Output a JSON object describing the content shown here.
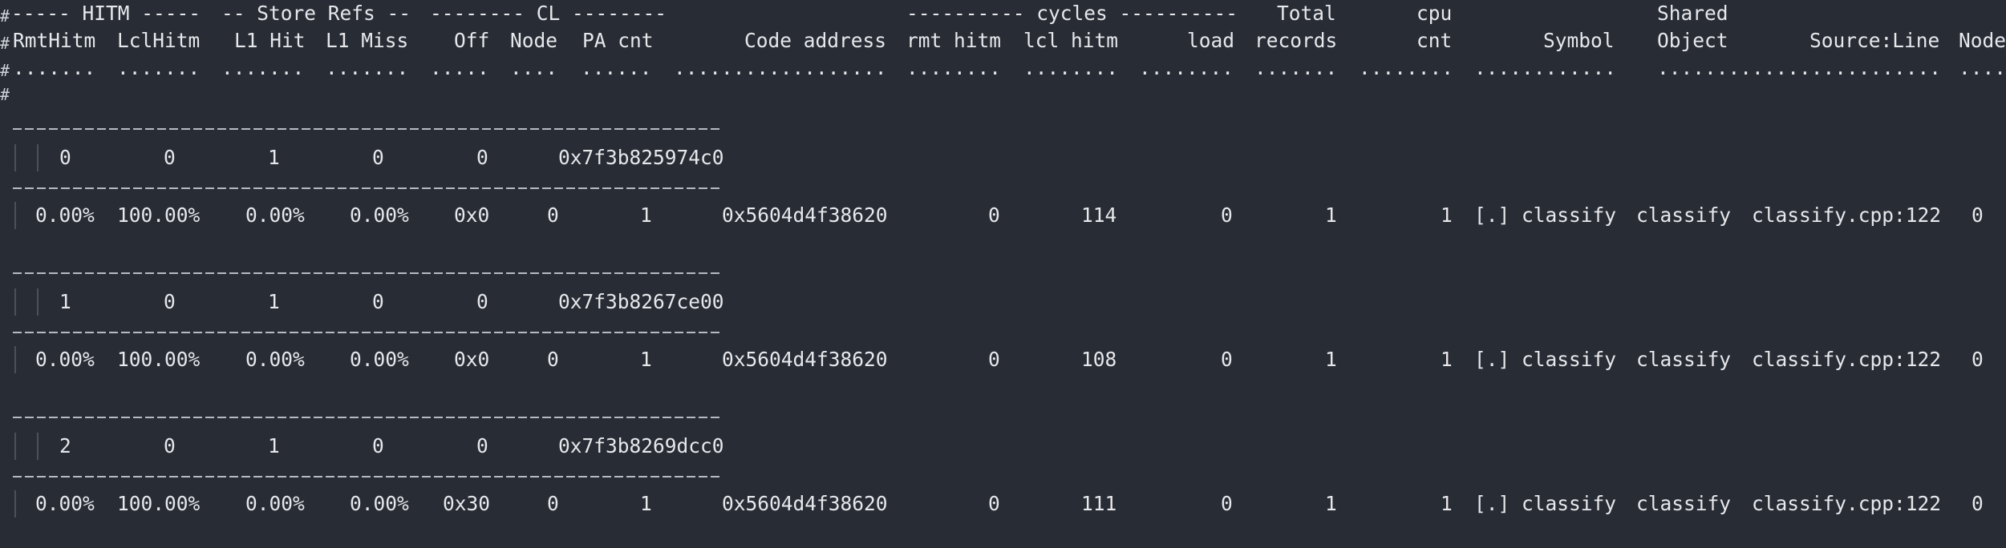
{
  "header": {
    "group_hitm": "----- HITM -----",
    "group_store": "-- Store Refs --",
    "group_cl": "-------- CL --------",
    "group_cycles": "---------- cycles ----------",
    "total_top": "Total",
    "cpu_top": "cpu",
    "shared_top": "Shared",
    "columns": {
      "rmt_hitm": "RmtHitm",
      "lcl_hitm": "LclHitm",
      "l1_hit": "L1 Hit",
      "l1_miss": "L1 Miss",
      "off": "Off",
      "node": "Node",
      "pa_cnt": "PA cnt",
      "code_address": "Code address",
      "cyc_rmt_hitm": "rmt hitm",
      "cyc_lcl_hitm": "lcl hitm",
      "cyc_load": "load",
      "total_records": "records",
      "cpu_cnt": "cnt",
      "symbol": "Symbol",
      "shared_object": "Object",
      "source_line": "Source:Line",
      "node_tail": "Node"
    },
    "dots": {
      "rmt_hitm": ".......",
      "lcl_hitm": ".......",
      "l1_hit": ".......",
      "l1_miss": ".......",
      "off": ".....",
      "node": "....",
      "pa_cnt": "......",
      "code_address": "..................",
      "cyc_rmt_hitm": "........",
      "cyc_lcl_hitm": "........",
      "cyc_load": "........",
      "total_records": ".......",
      "cpu_cnt": "........",
      "symbol": "............",
      "shared_object": "........",
      "source_line": "................",
      "node_tail": "...."
    }
  },
  "cachelines": [
    {
      "index": "0",
      "rmt_hitm": "0",
      "l1_hit": "1",
      "l1_miss": "0",
      "store_miss": "0",
      "address": "0x7f3b825974c0",
      "row": {
        "rmt_hitm": "0.00%",
        "lcl_hitm": "100.00%",
        "l1_hit": "0.00%",
        "l1_miss": "0.00%",
        "off": "0x0",
        "node": "0",
        "pa_cnt": "1",
        "code_address": "0x5604d4f38620",
        "cyc_rmt_hitm": "0",
        "cyc_lcl_hitm": "114",
        "cyc_load": "0",
        "total_records": "1",
        "cpu_cnt": "1",
        "symbol": "[.] classify",
        "shared_object": "classify",
        "source_line": "classify.cpp:122",
        "node_tail": "0"
      }
    },
    {
      "index": "1",
      "rmt_hitm": "0",
      "l1_hit": "1",
      "l1_miss": "0",
      "store_miss": "0",
      "address": "0x7f3b8267ce00",
      "row": {
        "rmt_hitm": "0.00%",
        "lcl_hitm": "100.00%",
        "l1_hit": "0.00%",
        "l1_miss": "0.00%",
        "off": "0x0",
        "node": "0",
        "pa_cnt": "1",
        "code_address": "0x5604d4f38620",
        "cyc_rmt_hitm": "0",
        "cyc_lcl_hitm": "108",
        "cyc_load": "0",
        "total_records": "1",
        "cpu_cnt": "1",
        "symbol": "[.] classify",
        "shared_object": "classify",
        "source_line": "classify.cpp:122",
        "node_tail": "0"
      }
    },
    {
      "index": "2",
      "rmt_hitm": "0",
      "l1_hit": "1",
      "l1_miss": "0",
      "store_miss": "0",
      "address": "0x7f3b8269dcc0",
      "row": {
        "rmt_hitm": "0.00%",
        "lcl_hitm": "100.00%",
        "l1_hit": "0.00%",
        "l1_miss": "0.00%",
        "off": "0x30",
        "node": "0",
        "pa_cnt": "1",
        "code_address": "0x5604d4f38620",
        "cyc_rmt_hitm": "0",
        "cyc_lcl_hitm": "111",
        "cyc_load": "0",
        "total_records": "1",
        "cpu_cnt": "1",
        "symbol": "[.] classify",
        "shared_object": "classify",
        "source_line": "classify.cpp:122",
        "node_tail": "0"
      }
    }
  ]
}
